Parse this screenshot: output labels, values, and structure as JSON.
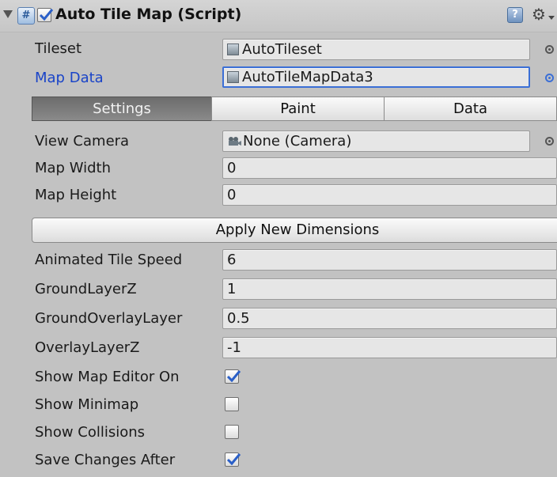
{
  "header": {
    "title": "Auto Tile Map (Script)",
    "enabled": true,
    "icons": [
      "foldout-arrow",
      "script-icon",
      "help-icon",
      "gear-icon"
    ]
  },
  "properties": {
    "tileset": {
      "label": "Tileset",
      "value": "AutoTileset"
    },
    "map_data": {
      "label": "Map Data",
      "value": "AutoTileMapData3"
    }
  },
  "tabs": [
    {
      "label": "Settings",
      "active": true
    },
    {
      "label": "Paint",
      "active": false
    },
    {
      "label": "Data",
      "active": false
    }
  ],
  "settings": {
    "view_camera": {
      "label": "View Camera",
      "value": "None (Camera)"
    },
    "map_width": {
      "label": "Map Width",
      "value": "0"
    },
    "map_height": {
      "label": "Map Height",
      "value": "0"
    },
    "apply_button": "Apply New Dimensions",
    "animated_tile_speed": {
      "label": "Animated Tile Speed",
      "value": "6"
    },
    "ground_layer_z": {
      "label": "GroundLayerZ",
      "value": "1"
    },
    "ground_overlay_layer": {
      "label": "GroundOverlayLayer",
      "value": "0.5"
    },
    "overlay_layer_z": {
      "label": "OverlayLayerZ",
      "value": "-1"
    },
    "show_map_editor": {
      "label": "Show Map Editor On",
      "checked": true
    },
    "show_minimap": {
      "label": "Show Minimap",
      "checked": false
    },
    "show_collisions": {
      "label": "Show Collisions",
      "checked": false
    },
    "save_changes_after": {
      "label": "Save Changes After",
      "checked": true
    }
  },
  "colors": {
    "panel_bg": "#c2c2c2",
    "accent_blue": "#3b6fd6",
    "label_blue": "#1a44c8"
  }
}
